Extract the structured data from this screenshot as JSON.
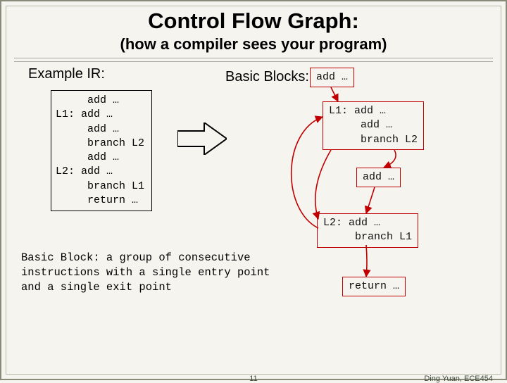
{
  "title": "Control Flow Graph:",
  "subtitle": "(how a compiler sees your program)",
  "ir_heading": "Example IR:",
  "bb_heading": "Basic Blocks:",
  "ir_code": "     add …\nL1: add …\n     add …\n     branch L2\n     add …\nL2: add …\n     branch L1\n     return …",
  "definition_term": "Basic Block:",
  "definition_body": " a group of consecutive\ninstructions with a single entry point\nand a single exit point",
  "blocks": {
    "b0": "add …",
    "b1": "L1: add …\n     add …\n     branch L2",
    "b2": "add …",
    "b3": "L2: add …\n     branch L1",
    "b4": "return …"
  },
  "chart_data": {
    "type": "diagram",
    "nodes": [
      {
        "id": "b0",
        "label": "add …"
      },
      {
        "id": "b1",
        "label": "L1: add … / add … / branch L2"
      },
      {
        "id": "b2",
        "label": "add …"
      },
      {
        "id": "b3",
        "label": "L2: add … / branch L1"
      },
      {
        "id": "b4",
        "label": "return …"
      }
    ],
    "edges": [
      {
        "from": "b0",
        "to": "b1"
      },
      {
        "from": "b1",
        "to": "b2"
      },
      {
        "from": "b1",
        "to": "b3"
      },
      {
        "from": "b2",
        "to": "b3"
      },
      {
        "from": "b3",
        "to": "b1",
        "back_edge": true
      },
      {
        "from": "b3",
        "to": "b4"
      }
    ]
  },
  "page_number": "11",
  "credit": "Ding Yuan, ECE454"
}
